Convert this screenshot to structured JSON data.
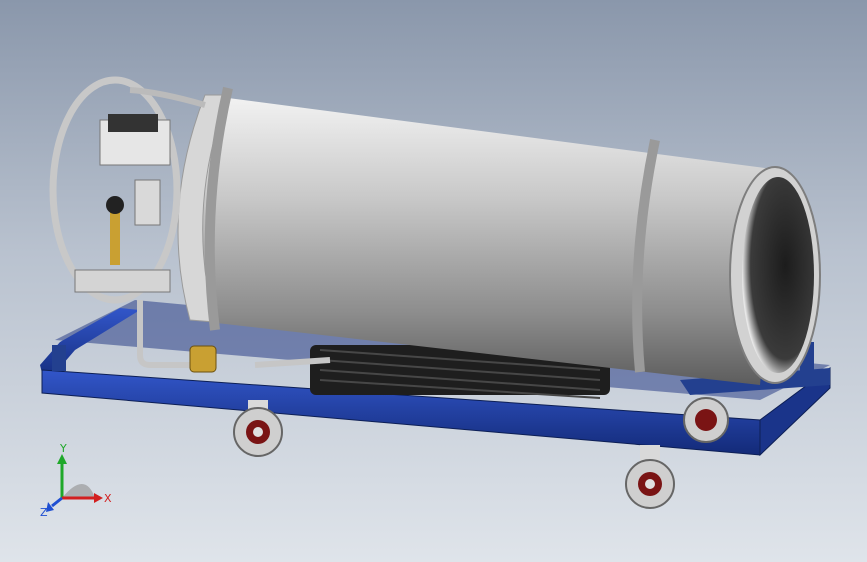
{
  "scene": {
    "subject": "cryogenic-tank-on-cart",
    "background_top": "#8a97ab",
    "background_bottom": "#dfe4ea",
    "frame_color": "#1f3a93",
    "tank_color": "#b9b9b9",
    "wheel_color": "#9e1b1b"
  },
  "axes": {
    "x_label": "X",
    "y_label": "Y",
    "z_label": "Z",
    "x_color": "#d21f1f",
    "y_color": "#1fa82a",
    "z_color": "#1f4fd2"
  }
}
